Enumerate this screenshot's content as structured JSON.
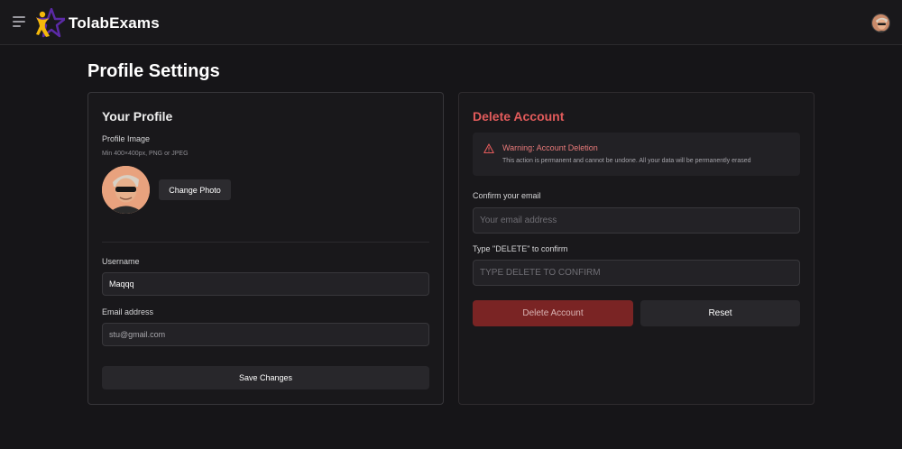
{
  "app": {
    "brand": "TolabExams"
  },
  "page": {
    "title": "Profile Settings"
  },
  "profile": {
    "title": "Your Profile",
    "image_label": "Profile Image",
    "image_hint": "Min 400×400px, PNG or JPEG",
    "change_photo_label": "Change Photo",
    "username_label": "Username",
    "username_value": "Maqqq",
    "email_label": "Email address",
    "email_value": "stu@gmail.com",
    "save_label": "Save Changes"
  },
  "delete_account": {
    "title": "Delete Account",
    "warning_title": "Warning: Account Deletion",
    "warning_text": "This action is permanent and cannot be undone. All your data will be permanently erased",
    "confirm_email_label": "Confirm your email",
    "confirm_email_placeholder": "Your email address",
    "confirm_delete_label": "Type \"DELETE\" to confirm",
    "confirm_delete_placeholder": "TYPE DELETE TO CONFIRM",
    "delete_label": "Delete Account",
    "reset_label": "Reset"
  },
  "icons": {
    "menu": "menu-icon",
    "logo": "star-person-logo-icon",
    "warning": "warning-triangle-icon"
  },
  "colors": {
    "background": "#161518",
    "card": "#19181b",
    "danger_title": "#e25b5b",
    "danger_button": "#7a2424",
    "logo_purple": "#5b2aa6",
    "logo_yellow": "#f5b80b"
  }
}
